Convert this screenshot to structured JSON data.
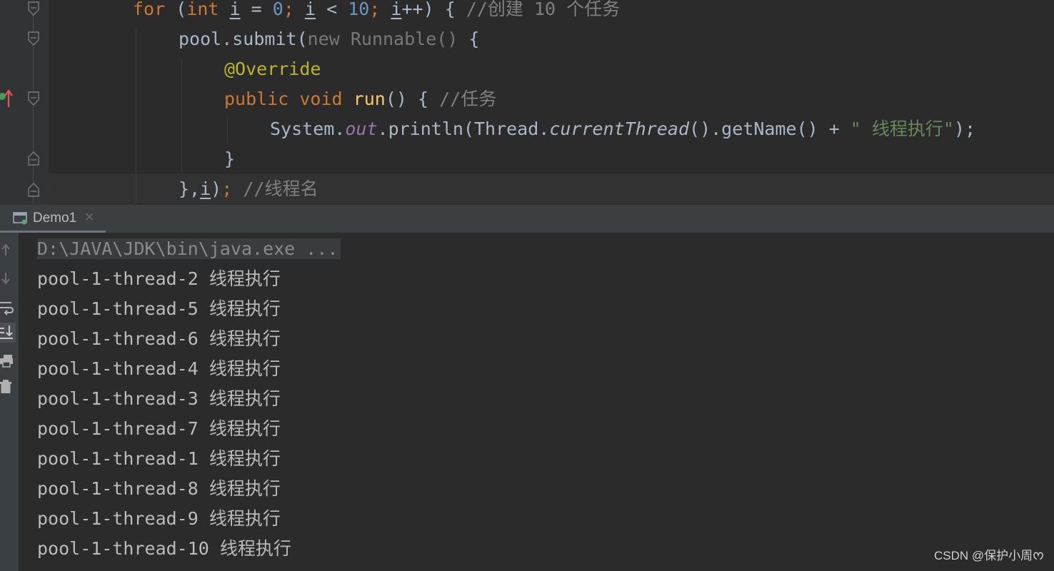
{
  "editor": {
    "for_keyword": "for",
    "for_open": "(",
    "int_keyword": "int",
    "var_i": "i",
    "assign": "=",
    "zero": "0",
    "semicolon": ";",
    "lt": "<",
    "ten": "10",
    "increment": "++",
    "brace_open": ") {",
    "comment_create_tasks": "//创建 10 个任务",
    "pool_submit": "pool.submit(",
    "new_keyword": "new",
    "runnable": "Runnable()",
    "brace": "{",
    "annotation": "@Override",
    "public_keyword": "public",
    "void_keyword": "void",
    "method_name": "run",
    "run_parens": "() {",
    "comment_task": "//任务",
    "system_prefix": "System.",
    "out_field": "out",
    "println_call": ".println(Thread.",
    "current_thread": "currentThread",
    "get_name": "().getName() + ",
    "string_literal": "\" 线程执行\"",
    "close_paren": ");",
    "close_brace": "}",
    "submit_close": "},",
    "submit_close_end": ")",
    "comment_thread_name": "//线程名"
  },
  "run_panel": {
    "tab_label": "Demo1",
    "tab_close": "×",
    "command_line": "D:\\JAVA\\JDK\\bin\\java.exe ...",
    "output_lines": [
      "pool-1-thread-2 线程执行",
      "pool-1-thread-5 线程执行",
      "pool-1-thread-6 线程执行",
      "pool-1-thread-4 线程执行",
      "pool-1-thread-3 线程执行",
      "pool-1-thread-7 线程执行",
      "pool-1-thread-1 线程执行",
      "pool-1-thread-8 线程执行",
      "pool-1-thread-9 线程执行",
      "pool-1-thread-10 线程执行"
    ]
  },
  "watermark": "CSDN @保护小周ᰔ",
  "icons": {
    "toolbar": [
      "up-arrow-icon",
      "down-arrow-icon",
      "soft-wrap-icon",
      "scroll-to-end-icon",
      "print-icon",
      "trash-icon"
    ],
    "gutter": [
      "fold-marker-icon",
      "override-method-icon"
    ],
    "tab": "run-config-icon"
  },
  "colors": {
    "keyword": "#cc7832",
    "number": "#6897bb",
    "comment": "#808080",
    "annotation": "#bbb529",
    "method": "#ffc66d",
    "string": "#6a8759",
    "field": "#9876aa",
    "background": "#2b2b2b"
  }
}
